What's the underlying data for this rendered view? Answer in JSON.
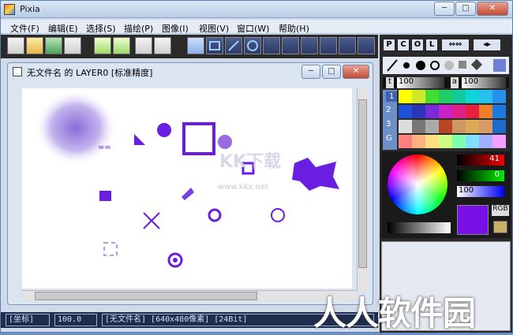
{
  "window": {
    "title": "Pixia",
    "min": "─",
    "max": "□",
    "close": "✕"
  },
  "menu": [
    "文件(F)",
    "编辑(E)",
    "选择(S)",
    "描绘(P)",
    "图像(I)",
    "视图(V)",
    "窗口(W)",
    "帮助(H)"
  ],
  "panel_tabs": [
    "P",
    "C",
    "O",
    "L"
  ],
  "doc": {
    "title": "无文件名 的 LAYER0 [标准精度]",
    "min": "─",
    "max": "□",
    "close": "✕"
  },
  "brush": {
    "size_label": "t",
    "size_value": "100",
    "alpha_label": "a",
    "alpha_value": "100"
  },
  "palette_rows": [
    "1",
    "2",
    "3",
    "G"
  ],
  "color": {
    "r": "41",
    "g": "0",
    "b": "100",
    "mode": "RGB",
    "current": "#7a10e8"
  },
  "watermark_canvas": {
    "brand": "KK下载",
    "url": "www.kkx.net"
  },
  "status": {
    "coord": "[坐标]",
    "zoom": "100.0",
    "info": "[无文件名] [640x480像素] [24Bit]"
  },
  "watermark": "人人软件园"
}
